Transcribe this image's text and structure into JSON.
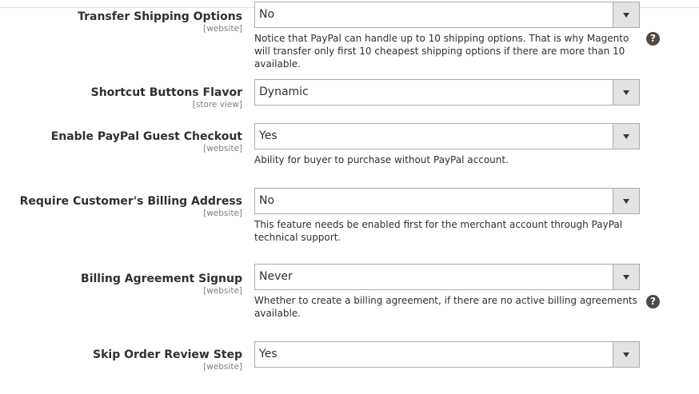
{
  "fields": [
    {
      "label": "Transfer Shipping Options",
      "scope": "[website]",
      "value": "No",
      "note": "Notice that PayPal can handle up to 10 shipping options. That is why Magento will transfer only first 10 cheapest shipping options if there are more than 10 available.",
      "help_icon": "?"
    },
    {
      "label": "Shortcut Buttons Flavor",
      "scope": "[store view]",
      "value": "Dynamic"
    },
    {
      "label": "Enable PayPal Guest Checkout",
      "scope": "[website]",
      "value": "Yes",
      "note": "Ability for buyer to purchase without PayPal account."
    },
    {
      "label": "Require Customer's Billing Address",
      "scope": "[website]",
      "value": "No",
      "note": "This feature needs be enabled first for the merchant account through PayPal technical support."
    },
    {
      "label": "Billing Agreement Signup",
      "scope": "[website]",
      "value": "Never",
      "note": "Whether to create a billing agreement, if there are no active billing agreements available.",
      "help_icon": "?"
    },
    {
      "label": "Skip Order Review Step",
      "scope": "[website]",
      "value": "Yes"
    }
  ],
  "icons": {
    "select_arrow": "chevron-down-icon",
    "help": "question-circle-icon"
  },
  "colors": {
    "text": "#303030",
    "scope": "#808080",
    "border": "#adadad",
    "arrow_bg": "#e3e3e3",
    "help_bg": "#514943"
  }
}
